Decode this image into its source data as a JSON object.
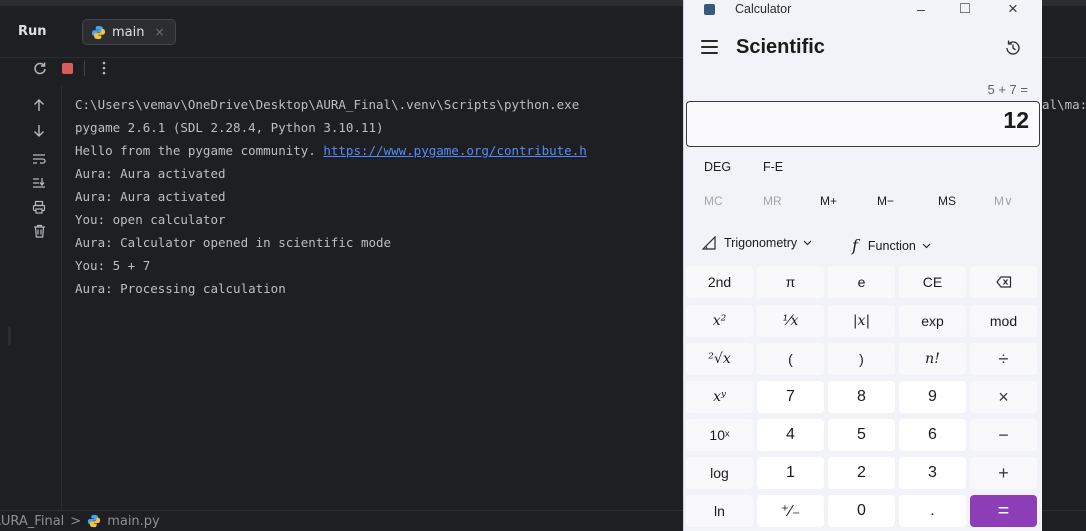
{
  "ide": {
    "run_label": "Run",
    "tab": {
      "label": "main",
      "close_glyph": "×"
    },
    "toolbar": {
      "icons": [
        "rerun-icon",
        "stop-icon",
        "more-icon"
      ]
    },
    "side_icons": [
      "arrow-up-icon",
      "arrow-down-icon",
      "soft-wrap-icon",
      "scroll-to-end-icon",
      "print-icon",
      "trash-icon"
    ],
    "console": {
      "lines": [
        {
          "text": "C:\\Users\\vemav\\OneDrive\\Desktop\\AURA_Final\\.venv\\Scripts\\python.exe",
          "link": ""
        },
        {
          "text": "pygame 2.6.1 (SDL 2.28.4, Python 3.10.11)",
          "link": ""
        },
        {
          "text": "Hello from the pygame community. ",
          "link": "https://www.pygame.org/contribute.h"
        },
        {
          "text": "Aura: Aura activated",
          "link": ""
        },
        {
          "text": "Aura: Aura activated",
          "link": ""
        },
        {
          "text": "You: open calculator",
          "link": ""
        },
        {
          "text": "Aura: Calculator opened in scientific mode",
          "link": ""
        },
        {
          "text": "You: 5 + 7",
          "link": ""
        },
        {
          "text": "Aura: Processing calculation",
          "link": ""
        }
      ],
      "overflow_text": "al\\ma:"
    },
    "status": {
      "project": "AURA_Final",
      "separator": ">",
      "file": "main.py"
    }
  },
  "calculator": {
    "window_title": "Calculator",
    "controls": {
      "minimize": "–",
      "maximize": "□",
      "close": "×"
    },
    "mode": "Scientific",
    "expression": "5 + 7 =",
    "display": "12",
    "angle_unit": "DEG",
    "notation": "F-E",
    "memory": [
      {
        "label": "MC",
        "enabled": false
      },
      {
        "label": "MR",
        "enabled": false
      },
      {
        "label": "M+",
        "enabled": true
      },
      {
        "label": "M−",
        "enabled": true
      },
      {
        "label": "MS",
        "enabled": true
      },
      {
        "label": "M∨",
        "enabled": false
      }
    ],
    "dropdowns": {
      "trig": "Trigonometry",
      "func": "Function"
    },
    "keys": [
      [
        "2nd",
        "π",
        "e",
        "CE",
        "⌫"
      ],
      [
        "x²",
        "¹⁄x",
        "|x|",
        "exp",
        "mod"
      ],
      [
        "²√x",
        "(",
        ")",
        "n!",
        "÷"
      ],
      [
        "xʸ",
        "7",
        "8",
        "9",
        "×"
      ],
      [
        "10ˣ",
        "4",
        "5",
        "6",
        "−"
      ],
      [
        "log",
        "1",
        "2",
        "3",
        "+"
      ],
      [
        "ln",
        "⁺⁄₋",
        "0",
        ".",
        "="
      ]
    ],
    "colors": {
      "accent": "#8d3db5",
      "background": "#f1f3f8"
    }
  }
}
